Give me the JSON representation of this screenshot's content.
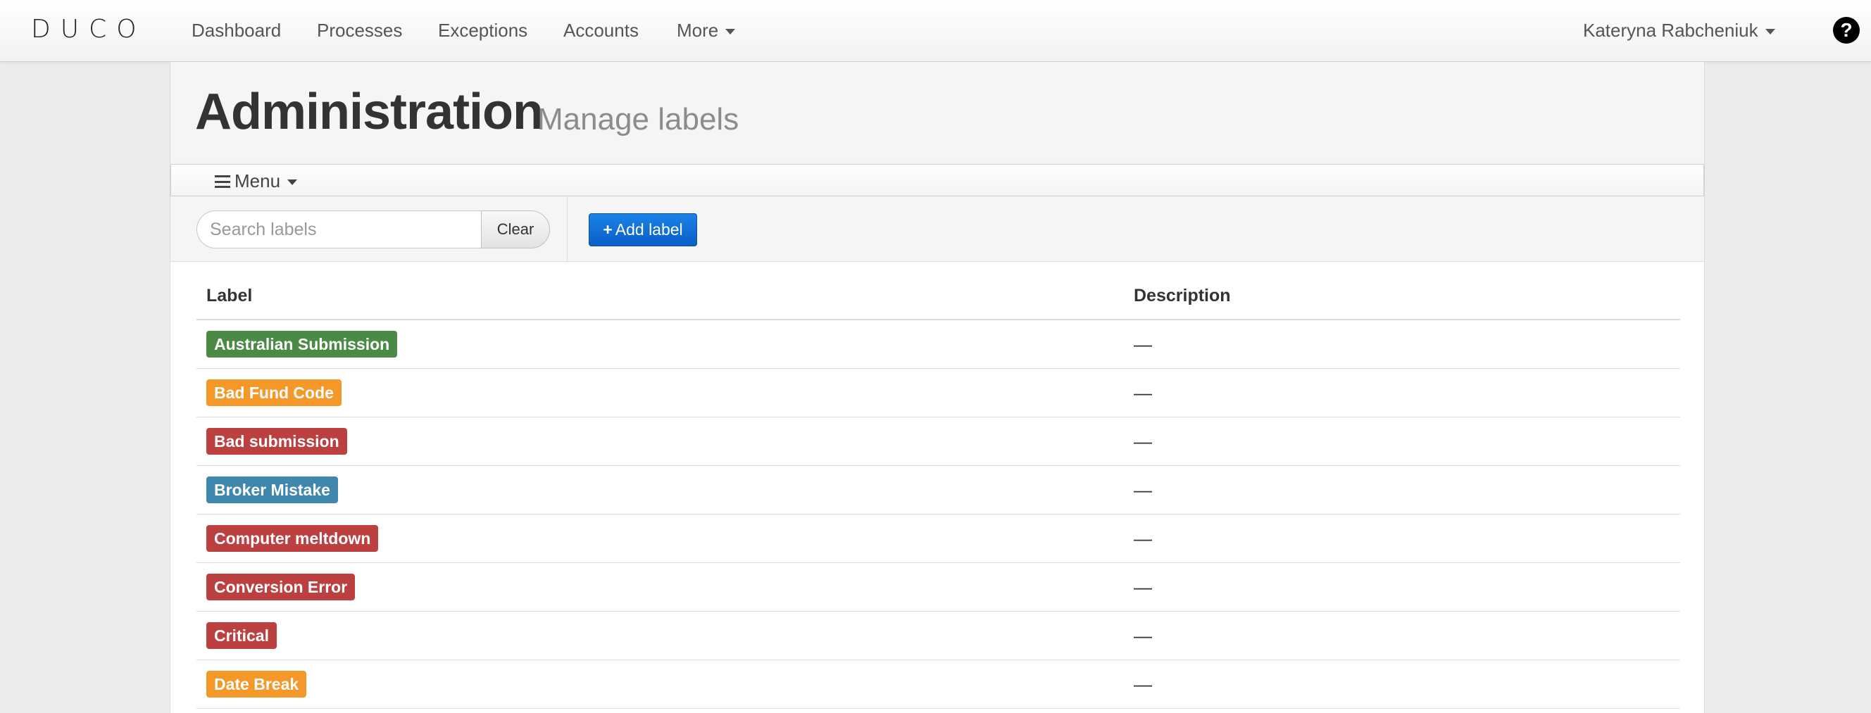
{
  "navbar": {
    "logo": "DUCO",
    "items": [
      {
        "label": "Dashboard"
      },
      {
        "label": "Processes"
      },
      {
        "label": "Exceptions"
      },
      {
        "label": "Accounts"
      },
      {
        "label": "More"
      }
    ],
    "user": "Kateryna Rabcheniuk",
    "help_icon": "question-circle-icon",
    "help_glyph": "?"
  },
  "header": {
    "title": "Administration",
    "subtitle": "Manage labels"
  },
  "menu": {
    "label": "Menu",
    "icon": "hamburger-icon"
  },
  "toolbar": {
    "search_placeholder": "Search labels",
    "search_value": "",
    "clear_label": "Clear",
    "add_label": "Add label",
    "add_glyph": "+"
  },
  "table": {
    "columns": {
      "label": "Label",
      "description": "Description"
    },
    "rows": [
      {
        "label": "Australian Submission",
        "description": "—",
        "color": "#4a8a45"
      },
      {
        "label": "Bad Fund Code",
        "description": "—",
        "color": "#f5982a"
      },
      {
        "label": "Bad submission",
        "description": "—",
        "color": "#bd4040"
      },
      {
        "label": "Broker Mistake",
        "description": "—",
        "color": "#3f87ad"
      },
      {
        "label": "Computer meltdown",
        "description": "—",
        "color": "#bd4040"
      },
      {
        "label": "Conversion Error",
        "description": "—",
        "color": "#bd4040"
      },
      {
        "label": "Critical",
        "description": "—",
        "color": "#bd4040"
      },
      {
        "label": "Date Break",
        "description": "—",
        "color": "#f5982a"
      }
    ]
  }
}
